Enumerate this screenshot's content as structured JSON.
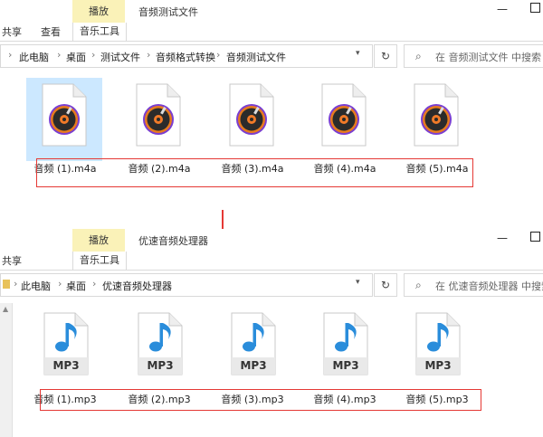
{
  "window1": {
    "context_tab": "播放",
    "title": "音频测试文件",
    "tabs": {
      "share": "共享",
      "view": "查看",
      "music_tools": "音乐工具"
    },
    "breadcrumb": [
      "此电脑",
      "桌面",
      "测试文件",
      "音频格式转换",
      "音频测试文件"
    ],
    "search_placeholder": "在 音频测试文件 中搜索",
    "files": [
      "音频 (1).m4a",
      "音频 (2).m4a",
      "音频 (3).m4a",
      "音频 (4).m4a",
      "音频 (5).m4a"
    ]
  },
  "window2": {
    "context_tab": "播放",
    "title": "优速音频处理器",
    "tabs": {
      "share": "共享",
      "music_tools": "音乐工具"
    },
    "breadcrumb": [
      "此电脑",
      "桌面",
      "优速音频处理器"
    ],
    "search_placeholder": "在 优速音频处理器 中搜索",
    "file_badge": "MP3",
    "files": [
      "音频 (1).mp3",
      "音频 (2).mp3",
      "音频 (3).mp3",
      "音频 (4).mp3",
      "音频 (5).mp3"
    ]
  },
  "colors": {
    "highlight": "#e53935",
    "context_tab": "#faf2b8",
    "selection": "#cce8ff",
    "mp3_note": "#2a8ddb"
  },
  "icons": {
    "refresh": "refresh-icon",
    "search": "search-icon",
    "minimize": "minimize-icon",
    "maximize": "maximize-icon"
  }
}
